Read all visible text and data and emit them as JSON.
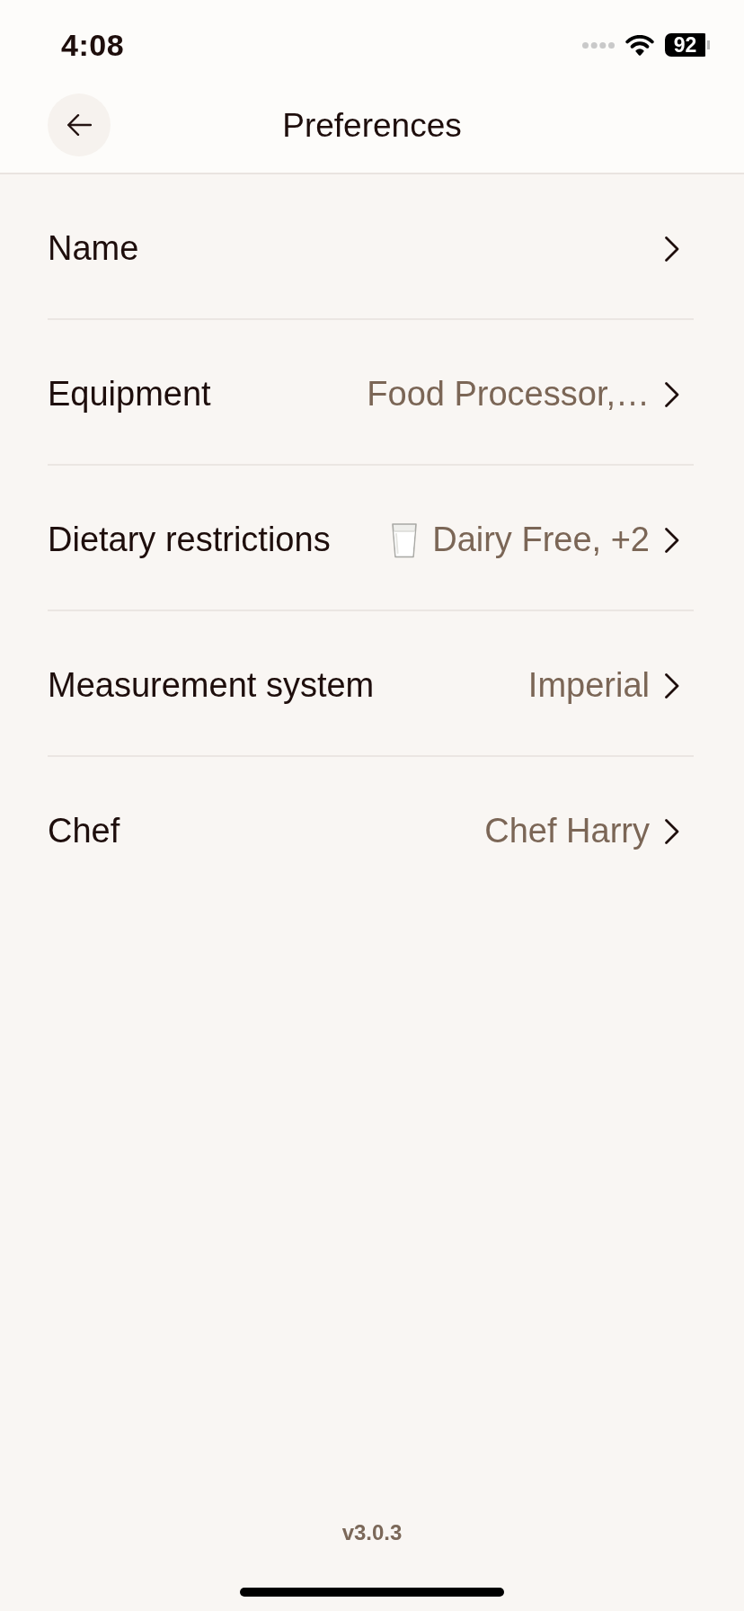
{
  "status_bar": {
    "time": "4:08",
    "battery": "92"
  },
  "header": {
    "title": "Preferences"
  },
  "rows": [
    {
      "label": "Name",
      "leading_icon": false
    },
    {
      "label": "Equipment",
      "value": "Food Processor,…",
      "leading_icon": false
    },
    {
      "label": "Dietary restrictions",
      "value": "Dairy Free, +2",
      "leading_icon": true
    },
    {
      "label": "Measurement system",
      "value": "Imperial",
      "leading_icon": false
    },
    {
      "label": "Chef",
      "value": "Chef Harry",
      "leading_icon": false
    }
  ],
  "footer": {
    "version": "v3.0.3"
  }
}
